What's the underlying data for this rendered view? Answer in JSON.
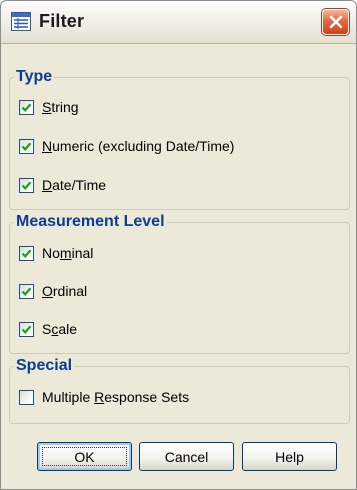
{
  "window": {
    "title": "Filter",
    "title_icon": "list-window-icon",
    "close_icon": "close-x-icon"
  },
  "groups": {
    "type": {
      "title": "Type",
      "items": [
        {
          "pre": "",
          "mn": "S",
          "post": "tring",
          "checked": true
        },
        {
          "pre": "",
          "mn": "N",
          "post": "umeric (excluding Date/Time)",
          "checked": true
        },
        {
          "pre": "",
          "mn": "D",
          "post": "ate/Time",
          "checked": true
        }
      ]
    },
    "measurement": {
      "title": "Measurement Level",
      "items": [
        {
          "pre": "No",
          "mn": "m",
          "post": "inal",
          "checked": true
        },
        {
          "pre": "",
          "mn": "O",
          "post": "rdinal",
          "checked": true
        },
        {
          "pre": "S",
          "mn": "c",
          "post": "ale",
          "checked": true
        }
      ]
    },
    "special": {
      "title": "Special",
      "items": [
        {
          "pre": "Multiple ",
          "mn": "R",
          "post": "esponse Sets",
          "checked": false
        }
      ]
    }
  },
  "buttons": {
    "ok": "OK",
    "cancel": "Cancel",
    "help": "Help"
  },
  "colors": {
    "dialog_bg": "#ECE9D8",
    "group_title": "#0B3D95",
    "check_mark": "#21A121",
    "close_button": "#E46B45"
  }
}
